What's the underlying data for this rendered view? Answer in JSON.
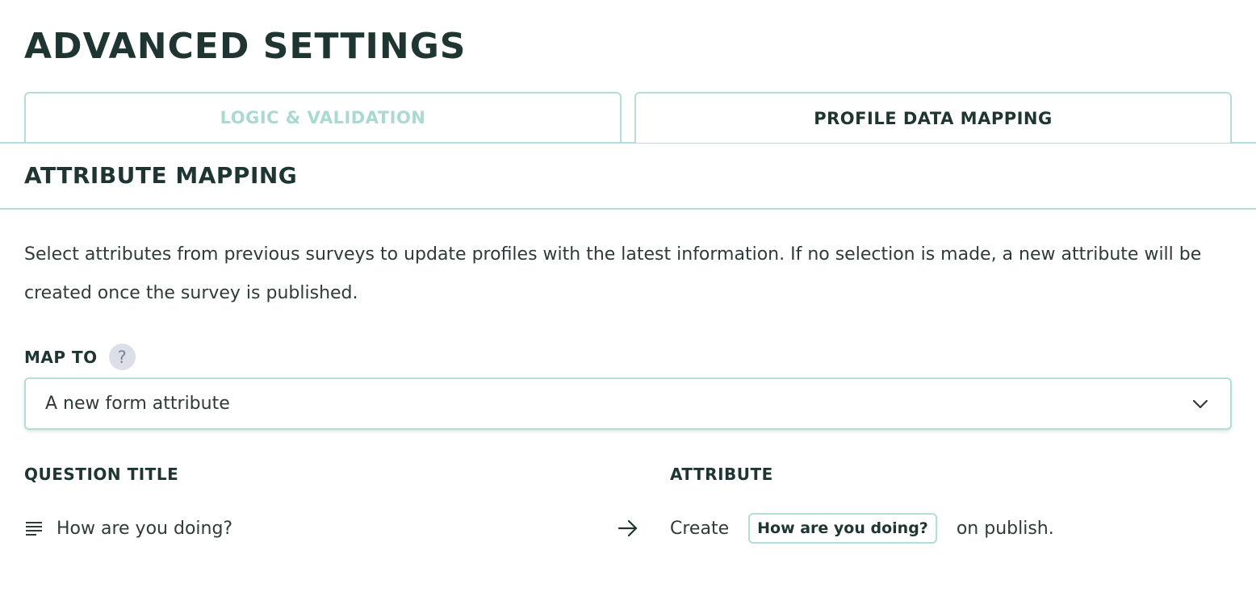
{
  "page": {
    "title": "ADVANCED SETTINGS"
  },
  "tabs": [
    {
      "label": "LOGIC & VALIDATION",
      "active": false
    },
    {
      "label": "PROFILE DATA MAPPING",
      "active": true
    }
  ],
  "section": {
    "title": "ATTRIBUTE MAPPING",
    "description": "Select attributes from previous surveys to update profiles with the latest information. If no selection is made, a new attribute will be created once the survey is published."
  },
  "map_to": {
    "label": "MAP TO",
    "help_icon": "question-mark-icon",
    "help_glyph": "?",
    "selected_value": "A new form attribute",
    "dropdown_icon": "chevron-down-icon"
  },
  "table": {
    "headers": {
      "question_title": "QUESTION TITLE",
      "attribute": "ATTRIBUTE"
    },
    "rows": [
      {
        "question_icon": "text-lines-icon",
        "question": "How are you doing?",
        "arrow_icon": "arrow-right-icon",
        "attribute_prefix": "Create",
        "attribute_name": "How are you doing?",
        "attribute_suffix": "on publish."
      }
    ]
  },
  "colors": {
    "accent_border": "#b4ddd6",
    "inactive_tab_text": "#a9d9d1",
    "heading_text": "#1e3531",
    "body_text": "#2e3b39",
    "help_icon_bg": "#dcdfe8"
  }
}
